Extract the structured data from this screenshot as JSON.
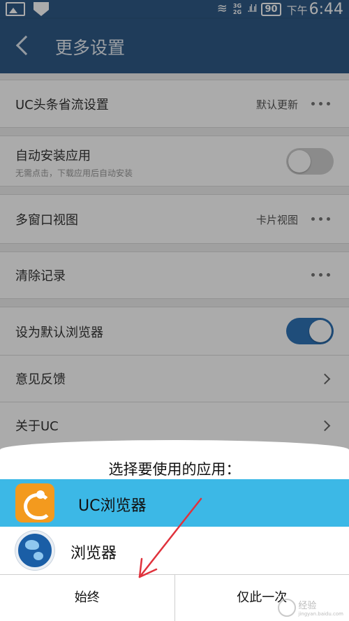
{
  "status_bar": {
    "network_top": "3G",
    "network_bottom": "2G",
    "battery": "90",
    "time_prefix": "下午",
    "time": "6:44"
  },
  "header": {
    "title": "更多设置"
  },
  "settings": {
    "traffic": {
      "label": "UC头条省流设置",
      "value": "默认更新"
    },
    "auto_install": {
      "label": "自动安装应用",
      "sub": "无需点击，下载应用后自动安装",
      "enabled": false
    },
    "multi_window": {
      "label": "多窗口视图",
      "value": "卡片视图"
    },
    "clear_history": {
      "label": "清除记录"
    },
    "default_browser": {
      "label": "设为默认浏览器",
      "enabled": true
    },
    "feedback": {
      "label": "意见反馈"
    },
    "about": {
      "label": "关于UC"
    }
  },
  "chooser": {
    "title": "选择要使用的应用：",
    "apps": [
      {
        "label": "UC浏览器",
        "icon": "uc-browser-icon",
        "selected": true
      },
      {
        "label": "浏览器",
        "icon": "globe-icon",
        "selected": false
      }
    ],
    "always_label": "始终",
    "once_label": "仅此一次"
  },
  "colors": {
    "header": "#2f5a86",
    "selected_row": "#3cb8e6",
    "toggle_on": "#2f73b6",
    "annotation": "#e0323c"
  },
  "watermark": {
    "text": "经验",
    "url": "jingyan.baidu.com"
  }
}
